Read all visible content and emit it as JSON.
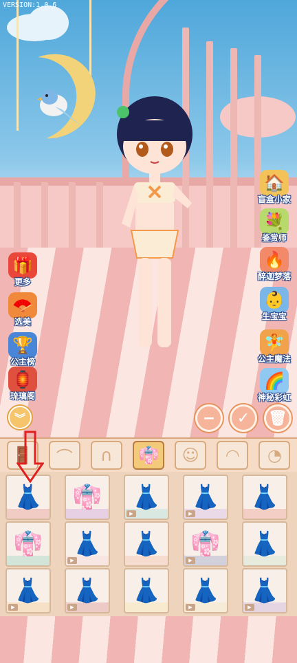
{
  "version": "VERSION:1.0.6",
  "left_buttons": [
    {
      "label": "更多",
      "icon": "gift-icon"
    },
    {
      "label": "选美",
      "icon": "fan-icon"
    },
    {
      "label": "公主榜",
      "icon": "trophy-icon"
    },
    {
      "label": "琉璃阁",
      "icon": "shop-icon"
    }
  ],
  "right_buttons": [
    {
      "label": "盲盒小家",
      "icon": "house-icon"
    },
    {
      "label": "鉴赏师",
      "icon": "bouquet-icon"
    },
    {
      "label": "醉迦梦落",
      "icon": "flame-icon"
    },
    {
      "label": "生宝宝",
      "icon": "baby-icon"
    },
    {
      "label": "公主魔法",
      "icon": "magic-icon"
    },
    {
      "label": "神秘彩虹",
      "icon": "rainbow-icon"
    }
  ],
  "actions": {
    "zoom_out": "−",
    "confirm": "✓",
    "delete": "🗑",
    "collapse": "︾"
  },
  "tabs": [
    {
      "name": "door-icon",
      "glyph": "🚪"
    },
    {
      "name": "hair-front-icon",
      "glyph": "⌒"
    },
    {
      "name": "hair-back-icon",
      "glyph": "∩"
    },
    {
      "name": "dress-icon",
      "glyph": "👘"
    },
    {
      "name": "face-icon",
      "glyph": "☺"
    },
    {
      "name": "bangs-icon",
      "glyph": "◠"
    },
    {
      "name": "head-icon",
      "glyph": "◔"
    }
  ],
  "items": [
    {
      "glyph": "👗",
      "color": "#d93b3b",
      "video": false
    },
    {
      "glyph": "👘",
      "color": "#a44fd0",
      "video": false
    },
    {
      "glyph": "👗",
      "color": "#5ec7c2",
      "video": true
    },
    {
      "glyph": "👗",
      "color": "#b37be0",
      "video": true
    },
    {
      "glyph": "👗",
      "color": "#e2483b",
      "video": false
    },
    {
      "glyph": "👘",
      "color": "#3fb7a0",
      "video": false
    },
    {
      "glyph": "👗",
      "color": "#f5c0c8",
      "video": true
    },
    {
      "glyph": "👗",
      "color": "#f28a6a",
      "video": false
    },
    {
      "glyph": "👘",
      "color": "#3b4fa8",
      "video": true
    },
    {
      "glyph": "👗",
      "color": "#9fd6b8",
      "video": false
    },
    {
      "glyph": "👗",
      "color": "#f0a640",
      "video": true
    },
    {
      "glyph": "👗",
      "color": "#c0303a",
      "video": true
    },
    {
      "glyph": "👗",
      "color": "#f3d36a",
      "video": false
    },
    {
      "glyph": "👗",
      "color": "#e9d88f",
      "video": true
    },
    {
      "glyph": "👗",
      "color": "#9a6ad0",
      "video": true
    }
  ]
}
